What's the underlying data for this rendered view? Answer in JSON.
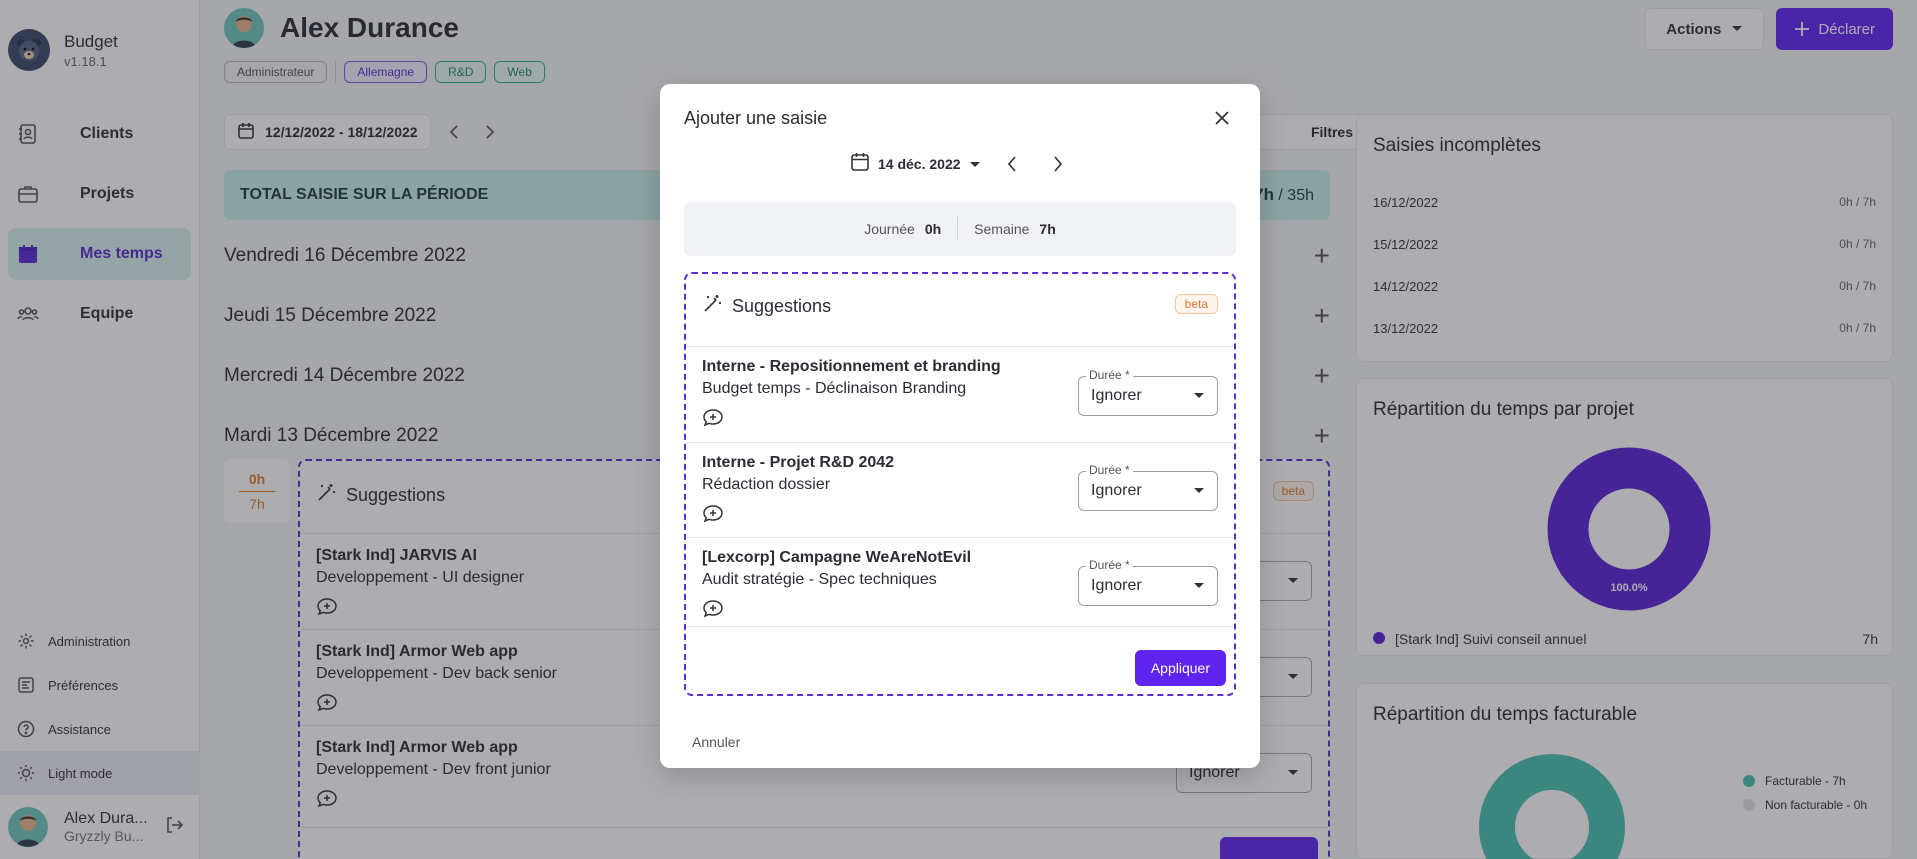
{
  "app": {
    "name": "Budget",
    "version": "v1.18.1"
  },
  "sidebar": {
    "items": [
      {
        "label": "Clients",
        "icon": "contacts-icon"
      },
      {
        "label": "Projets",
        "icon": "briefcase-icon"
      },
      {
        "label": "Mes temps",
        "icon": "calendar-icon"
      },
      {
        "label": "Equipe",
        "icon": "team-icon"
      }
    ],
    "bottom": [
      {
        "label": "Administration",
        "icon": "gear-icon"
      },
      {
        "label": "Préférences",
        "icon": "preferences-icon"
      },
      {
        "label": "Assistance",
        "icon": "help-icon"
      },
      {
        "label": "Light mode",
        "icon": "sun-icon"
      }
    ],
    "user": {
      "name": "Alex Dura...",
      "company": "Gryzzly Bu..."
    }
  },
  "profile": {
    "name": "Alex Durance",
    "tags": [
      "Administrateur",
      "Allemagne",
      "R&D",
      "Web"
    ]
  },
  "toolbar": {
    "actions_label": "Actions",
    "declare_label": "Déclarer",
    "filters_label": "Filtres"
  },
  "period": {
    "range": "12/12/2022 - 18/12/2022"
  },
  "total": {
    "label": "TOTAL SAISIE SUR LA PÉRIODE",
    "value": "7h",
    "target": "/ 35h"
  },
  "days": [
    "Vendredi 16 Décembre 2022",
    "Jeudi 15 Décembre 2022",
    "Mercredi 14 Décembre 2022",
    "Mardi 13 Décembre 2022"
  ],
  "tuesday": {
    "done": "0h",
    "target": "7h"
  },
  "background_suggestions": {
    "title": "Suggestions",
    "beta": "beta",
    "items": [
      {
        "title": "[Stark Ind] JARVIS AI",
        "subtitle": "Developpement - UI designer"
      },
      {
        "title": "[Stark Ind] Armor Web app",
        "subtitle": "Developpement - Dev back senior"
      },
      {
        "title": "[Stark Ind] Armor Web app",
        "subtitle": "Developpement - Dev front junior",
        "select": "Ignorer"
      }
    ]
  },
  "incomplete": {
    "title": "Saisies incomplètes",
    "rows": [
      {
        "date": "16/12/2022",
        "hours": "0h / 7h"
      },
      {
        "date": "15/12/2022",
        "hours": "0h / 7h"
      },
      {
        "date": "14/12/2022",
        "hours": "0h / 7h"
      },
      {
        "date": "13/12/2022",
        "hours": "0h / 7h"
      }
    ]
  },
  "project_split": {
    "title": "Répartition du temps par projet",
    "center_label": "100.0%",
    "legend": [
      {
        "label": "[Stark Ind] Suivi conseil annuel",
        "value": "7h",
        "color": "#5b21d8"
      }
    ]
  },
  "billable_split": {
    "title": "Répartition du temps facturable",
    "legend": [
      {
        "label": "Facturable - 7h",
        "color": "#49c3b3"
      },
      {
        "label": "Non facturable - 0h",
        "color": "#e2e4ea"
      }
    ]
  },
  "modal": {
    "title": "Ajouter une saisie",
    "date": "14 déc. 2022",
    "summary": {
      "day_label": "Journée",
      "day_value": "0h",
      "week_label": "Semaine",
      "week_value": "7h"
    },
    "suggestions": {
      "title": "Suggestions",
      "beta": "beta",
      "duree_label": "Durée *",
      "items": [
        {
          "title": "Interne - Repositionnement et branding",
          "subtitle": "Budget temps - Déclinaison Branding",
          "value": "Ignorer"
        },
        {
          "title": "Interne - Projet R&D 2042",
          "subtitle": "Rédaction dossier",
          "value": "Ignorer"
        },
        {
          "title": "[Lexcorp] Campagne WeAreNotEvil",
          "subtitle": "Audit stratégie - Spec techniques",
          "value": "Ignorer"
        }
      ],
      "apply_label": "Appliquer"
    },
    "cancel_label": "Annuler"
  }
}
